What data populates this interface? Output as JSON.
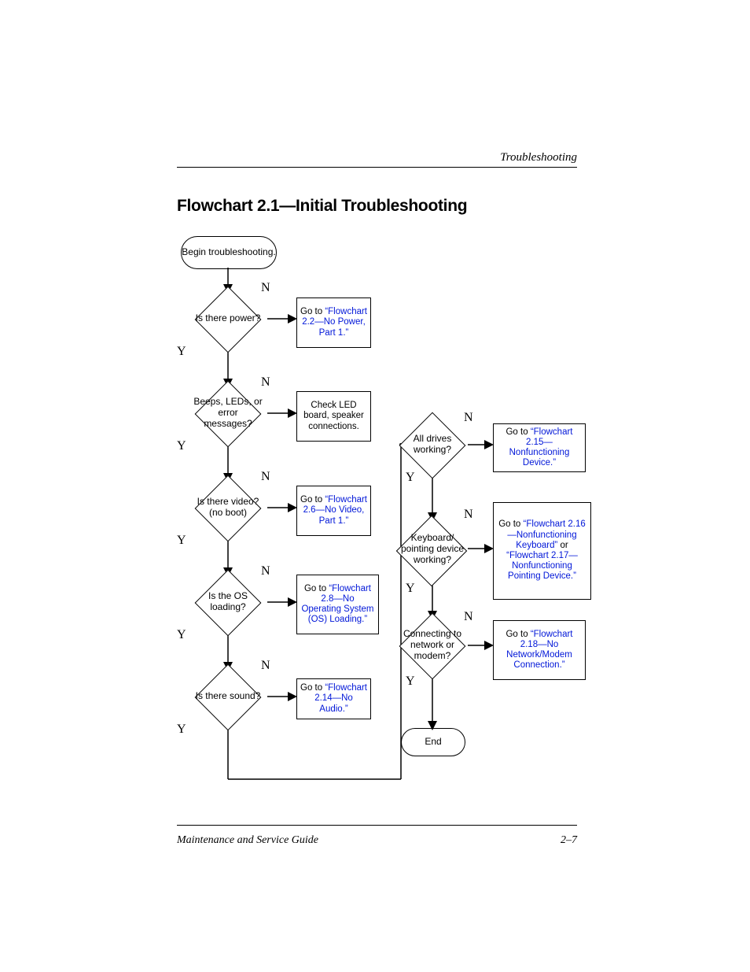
{
  "header": {
    "section": "Troubleshooting"
  },
  "title": "Flowchart 2.1—Initial Troubleshooting",
  "footer": {
    "left": "Maintenance and Service Guide",
    "right": "2–7"
  },
  "labels": {
    "Y": "Y",
    "N": "N"
  },
  "nodes": {
    "begin": {
      "text": "Begin troubleshooting."
    },
    "end": {
      "text": "End"
    },
    "d_power": {
      "text": "Is there power?"
    },
    "d_beeps": {
      "text": "Beeps, LEDs, or error messages?"
    },
    "d_video": {
      "text": "Is there video? (no boot)"
    },
    "d_os": {
      "text": "Is the OS loading?"
    },
    "d_sound": {
      "text": "Is there sound?"
    },
    "d_drives": {
      "text": "All drives working?"
    },
    "d_kbd": {
      "text": "Keyboard/ pointing device working?"
    },
    "d_net": {
      "text": "Connecting to network or modem?"
    },
    "r_power": {
      "pre": "Go to ",
      "link": "“Flowchart 2.2—No Power, Part 1.”"
    },
    "r_beeps": {
      "text": "Check LED board, speaker connections."
    },
    "r_video": {
      "pre": "Go to ",
      "link": "“Flowchart 2.6—No Video, Part 1.”"
    },
    "r_os": {
      "pre": "Go to ",
      "link": "“Flowchart 2.8—No Operating System (OS) Loading.”"
    },
    "r_sound": {
      "pre": "Go to ",
      "link": "“Flowchart 2.14—No Audio.”"
    },
    "r_drives": {
      "pre": "Go to ",
      "link": "“Flowchart 2.15—Nonfunctioning Device.”"
    },
    "r_kbd": {
      "pre": "Go to ",
      "link1": "“Flowchart 2.16—Nonfunctioning Keyboard”",
      "mid": " or ",
      "link2": "“Flowchart 2.17—Nonfunctioning Pointing Device.”"
    },
    "r_net": {
      "pre": "Go to ",
      "link": "“Flowchart 2.18—No Network/Modem Connection.”"
    }
  }
}
